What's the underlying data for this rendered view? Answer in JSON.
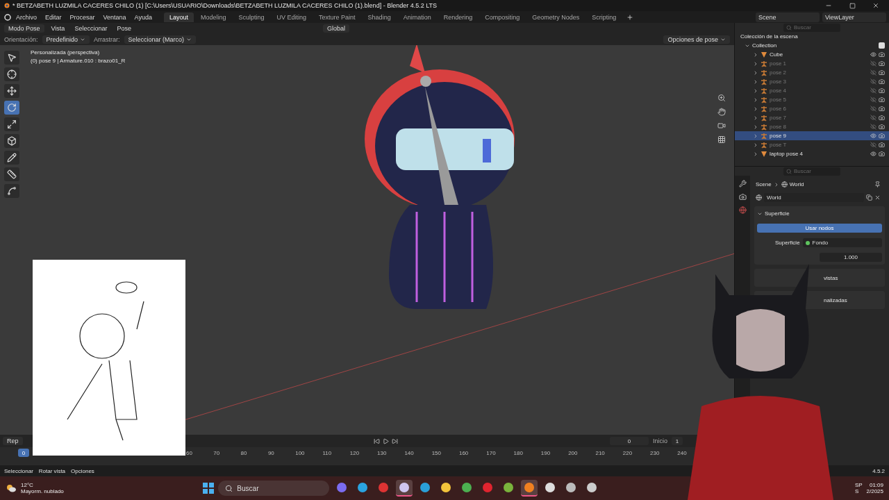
{
  "window": {
    "title": "* BETZABETH LUZMILA CACERES CHILO (1) [C:\\Users\\USUARIO\\Downloads\\BETZABETH LUZMILA CACERES CHILO (1).blend] - Blender 4.5.2 LTS"
  },
  "menu": [
    "Archivo",
    "Editar",
    "Procesar",
    "Ventana",
    "Ayuda"
  ],
  "workspaces": [
    {
      "label": "Layout",
      "selected": true
    },
    {
      "label": "Modeling",
      "selected": false
    },
    {
      "label": "Sculpting",
      "selected": false
    },
    {
      "label": "UV Editing",
      "selected": false
    },
    {
      "label": "Texture Paint",
      "selected": false
    },
    {
      "label": "Shading",
      "selected": false
    },
    {
      "label": "Animation",
      "selected": false
    },
    {
      "label": "Rendering",
      "selected": false
    },
    {
      "label": "Compositing",
      "selected": false
    },
    {
      "label": "Geometry Nodes",
      "selected": false
    },
    {
      "label": "Scripting",
      "selected": false
    }
  ],
  "scene": "Scene",
  "view_layer": "ViewLayer",
  "viewport_header": {
    "mode": "Modo Pose",
    "menus": [
      "Vista",
      "Seleccionar",
      "Pose"
    ],
    "orientation": "Global"
  },
  "tool_settings": {
    "orientation_label": "Orientación:",
    "orientation": "Predefinido",
    "drag_label": "Arrastrar:",
    "drag": "Seleccionar (Marco)",
    "pose_options": "Opciones de pose"
  },
  "viewport": {
    "view_name": "Personalizada (perspectiva)",
    "object_info": "(0) pose 9 | Armature.010 : brazo01_R"
  },
  "tools": [
    {
      "kind": "select",
      "selected": false
    },
    {
      "kind": "cursor",
      "selected": false
    },
    {
      "kind": "move",
      "selected": false
    },
    {
      "kind": "rotate",
      "selected": true
    },
    {
      "kind": "scale",
      "selected": false
    },
    {
      "kind": "transform",
      "selected": false
    },
    {
      "kind": "annotate",
      "selected": false
    },
    {
      "kind": "measure",
      "selected": false
    },
    {
      "kind": "bone",
      "selected": false
    }
  ],
  "outliner": {
    "search_placeholder": "Buscar",
    "root": "Colección de la escena",
    "collection": {
      "name": "Collection",
      "checked": true,
      "expanded": true,
      "children": [
        {
          "name": "Cube",
          "kind": "mesh",
          "selected": false,
          "visible": true
        },
        {
          "name": "pose 1",
          "kind": "armature",
          "selected": false,
          "visible": false
        },
        {
          "name": "pose 2",
          "kind": "armature",
          "selected": false,
          "visible": false
        },
        {
          "name": "pose 3",
          "kind": "armature",
          "selected": false,
          "visible": false
        },
        {
          "name": "pose 4",
          "kind": "armature",
          "selected": false,
          "visible": false
        },
        {
          "name": "pose 5",
          "kind": "armature",
          "selected": false,
          "visible": false
        },
        {
          "name": "pose 6",
          "kind": "armature",
          "selected": false,
          "visible": false
        },
        {
          "name": "pose 7",
          "kind": "armature",
          "selected": false,
          "visible": false
        },
        {
          "name": "pose 8",
          "kind": "armature",
          "selected": false,
          "visible": false
        },
        {
          "name": "pose 9",
          "kind": "armature",
          "selected": true,
          "visible": true
        },
        {
          "name": "pose T",
          "kind": "armature",
          "selected": false,
          "visible": false
        },
        {
          "name": "laptop pose 4",
          "kind": "mesh",
          "selected": false,
          "visible": true
        }
      ]
    }
  },
  "properties": {
    "search_placeholder": "Buscar",
    "breadcrumb": [
      "Scene",
      "World"
    ],
    "world": "World",
    "panel": {
      "title": "Superficie",
      "expanded": true
    },
    "use_nodes": "Usar nodos",
    "surface_label": "Superficie",
    "surface_value": "Fondo",
    "strength": "1.000",
    "subpanels": [
      "vistas",
      "nalizadas"
    ]
  },
  "timeline": {
    "mode": "Rep",
    "playhead": "0",
    "current_frame": "0",
    "start_label": "Inicio",
    "start": "1",
    "ticks": [
      "60",
      "70",
      "80",
      "90",
      "100",
      "110",
      "120",
      "130",
      "140",
      "150",
      "160",
      "170",
      "180",
      "190",
      "200",
      "210",
      "220",
      "230",
      "240"
    ]
  },
  "status_bar": {
    "hints": [
      "Seleccionar",
      "Rotar vista",
      "Opciones"
    ],
    "version": "4.5.2"
  },
  "taskbar": {
    "temperature": "12°C",
    "weather": "Mayorm. nublado",
    "search_placeholder": "Buscar",
    "apps": [
      {
        "kind": "copilot",
        "selected": false
      },
      {
        "kind": "telegram",
        "selected": false
      },
      {
        "kind": "music",
        "selected": false
      },
      {
        "kind": "obs",
        "selected": true
      },
      {
        "kind": "edge",
        "selected": false
      },
      {
        "kind": "files",
        "selected": false
      },
      {
        "kind": "chrome",
        "selected": false
      },
      {
        "kind": "opera",
        "selected": false
      },
      {
        "kind": "editor",
        "selected": false
      },
      {
        "kind": "blender",
        "selected": true
      },
      {
        "kind": "recorder",
        "selected": false
      },
      {
        "kind": "camera",
        "selected": false
      },
      {
        "kind": "settings",
        "selected": false
      }
    ],
    "language": "SP",
    "language_sub": "S",
    "time": "01:09",
    "date": "2/2025"
  }
}
